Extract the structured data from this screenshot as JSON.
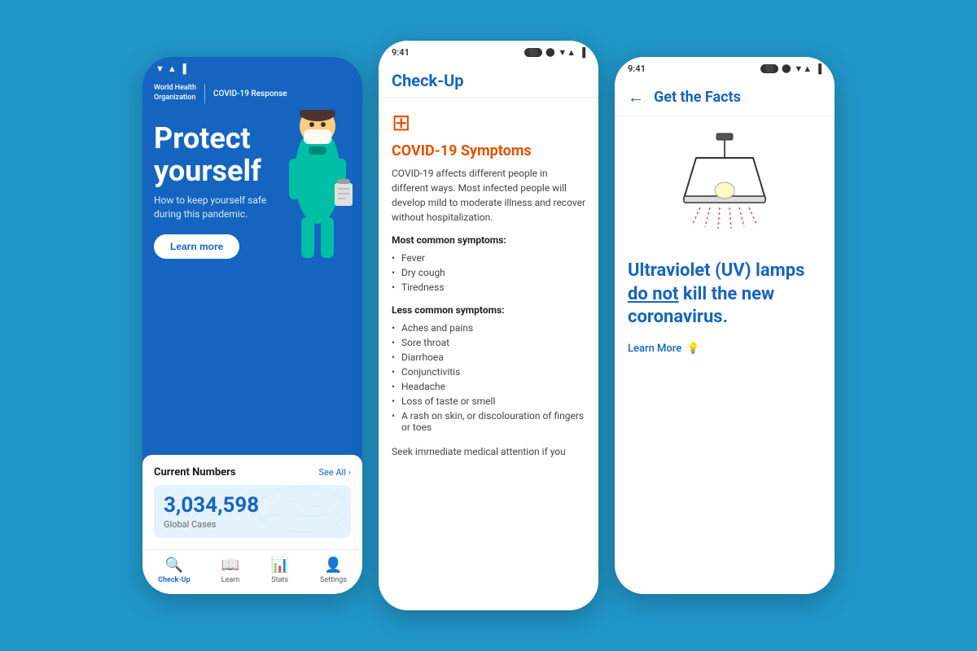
{
  "background_color": "#2196C9",
  "phone1": {
    "status_bar": {
      "time": "",
      "icons": "▼ ▲ ▐"
    },
    "header": {
      "who_line1": "World Health",
      "who_line2": "Organization",
      "covid_label": "COVID-19 Response"
    },
    "hero": {
      "title_line1": "Protect",
      "title_line2": "yourself",
      "subtitle": "How to keep yourself safe\nduring this pandemic.",
      "button_label": "Learn more"
    },
    "stats": {
      "section_title": "Current Numbers",
      "see_all": "See All ›",
      "number": "3,034,598",
      "label": "Global Cases"
    },
    "nav": [
      {
        "icon": "🔍",
        "label": "Check-Up",
        "active": true
      },
      {
        "icon": "📖",
        "label": "Learn",
        "active": false
      },
      {
        "icon": "📊",
        "label": "Stats",
        "active": false
      },
      {
        "icon": "👤",
        "label": "Settings",
        "active": false
      }
    ]
  },
  "phone2": {
    "status_bar": {
      "time": "9:41"
    },
    "header": {
      "title": "Check-Up"
    },
    "section": {
      "icon": "🏥",
      "title": "COVID-19 Symptoms",
      "description": "COVID-19 affects different people in different ways. Most infected people will develop mild to moderate illness and recover without hospitalization.",
      "common_label": "Most common symptoms:",
      "common_items": [
        "Fever",
        "Dry cough",
        "Tiredness"
      ],
      "less_common_label": "Less common symptoms:",
      "less_common_items": [
        "Aches and pains",
        "Sore throat",
        "Diarrhoea",
        "Conjunctivitis",
        "Headache",
        "Loss of taste or smell",
        "A rash on skin, or discolouration of fingers or toes"
      ],
      "seek_text": "Seek immediate medical attention if you"
    }
  },
  "phone3": {
    "status_bar": {
      "time": "9:41"
    },
    "header": {
      "back_icon": "←",
      "title": "Get the Facts"
    },
    "fact": {
      "main_text_before": "Ultraviolet (UV) lamps ",
      "main_text_emphasis": "do not",
      "main_text_after": " kill the new coronavirus.",
      "learn_more": "Learn More"
    }
  }
}
